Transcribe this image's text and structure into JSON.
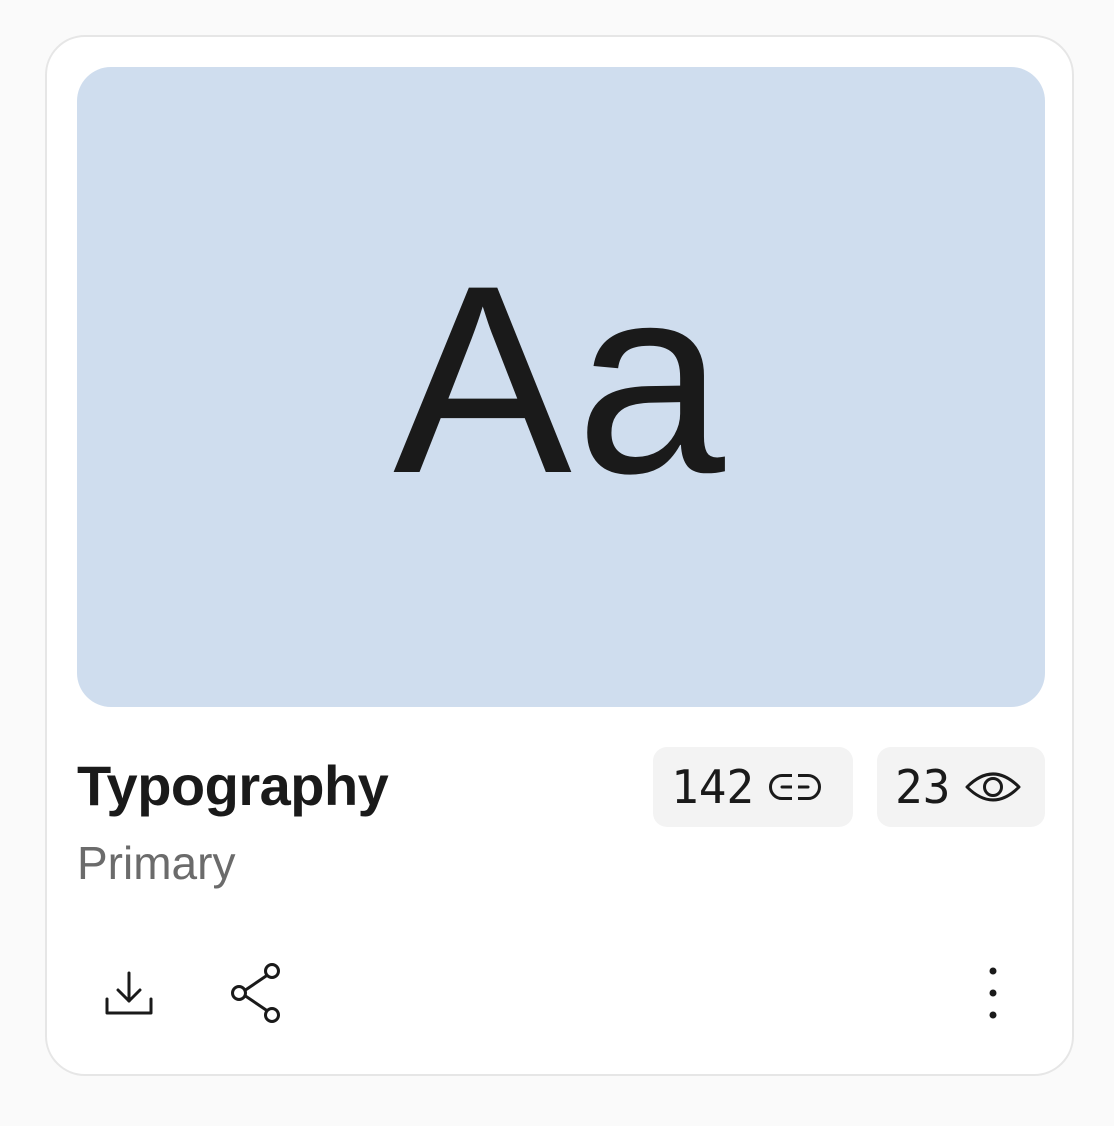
{
  "card": {
    "preview_text": "Aa",
    "preview_background": "#cfddee",
    "title": "Typography",
    "subtitle": "Primary",
    "stats": {
      "links": {
        "value": "142",
        "icon": "link-icon"
      },
      "views": {
        "value": "23",
        "icon": "eye-icon"
      }
    },
    "actions": [
      {
        "icon": "download-icon"
      },
      {
        "icon": "share-icon"
      },
      {
        "icon": "more-vertical-icon"
      }
    ]
  }
}
